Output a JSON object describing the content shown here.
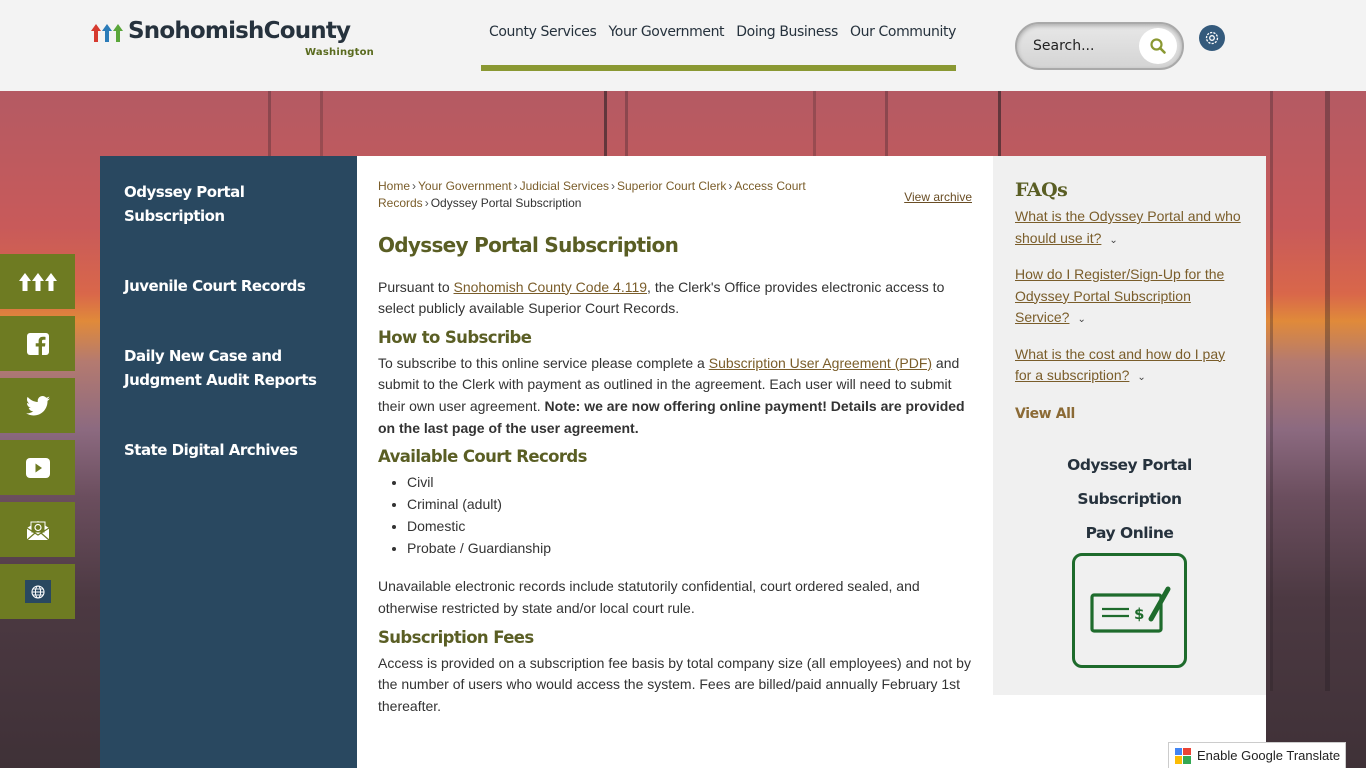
{
  "header": {
    "logo_text": "SnohomishCounty",
    "logo_sub": "Washington",
    "nav": [
      "County Services",
      "Your Government",
      "Doing Business",
      "Our Community"
    ],
    "search_placeholder": "Search...",
    "search_icon": "search-icon",
    "settings_icon": "gear-icon"
  },
  "colors": {
    "olive": "#6e7b22",
    "nav_underline": "#8a9832",
    "navy": "#294860",
    "heading": "#5a5e24",
    "link": "#7a5d2a",
    "pay_green": "#1e6b2c"
  },
  "social": [
    {
      "name": "county-logo-icon"
    },
    {
      "name": "facebook-icon"
    },
    {
      "name": "twitter-icon"
    },
    {
      "name": "youtube-icon"
    },
    {
      "name": "email-icon"
    },
    {
      "name": "globe-icon"
    }
  ],
  "sidebar": {
    "items": [
      {
        "label": "Odyssey Portal Subscription"
      },
      {
        "label": "Juvenile Court Records"
      },
      {
        "label": "Daily New Case and Judgment Audit Reports"
      },
      {
        "label": "State Digital Archives"
      }
    ]
  },
  "breadcrumb": {
    "items": [
      "Home",
      "Your Government",
      "Judicial Services",
      "Superior Court Clerk",
      "Access Court Records"
    ],
    "current": "Odyssey Portal Subscription",
    "separator": "›"
  },
  "view_archive": "View archive",
  "main": {
    "title": "Odyssey Portal Subscription",
    "intro_before": "Pursuant to ",
    "intro_link": "Snohomish County Code 4.119",
    "intro_after": ", the Clerk's Office provides electronic access to select publicly available Superior Court Records.",
    "how_heading": "How to Subscribe",
    "how_before": "To subscribe to this online service please complete a ",
    "how_link": "Subscription User Agreement (PDF)",
    "how_after": " and submit to the Clerk with payment as outlined in the agreement. Each user will need to submit their own user agreement. ",
    "how_bold": "Note: we are now offering online payment! Details are provided on the last page of the user agreement.",
    "records_heading": "Available Court Records",
    "records": [
      "Civil",
      "Criminal (adult)",
      "Domestic",
      "Probate / Guardianship"
    ],
    "unavailable": "Unavailable electronic records include statutorily confidential, court ordered sealed, and otherwise restricted by state and/or local court rule.",
    "fees_heading": "Subscription Fees",
    "fees_text": "Access is provided on a subscription fee basis by total company size (all employees) and not by the number of users who would access the system. Fees are billed/paid annually February 1st thereafter."
  },
  "aside": {
    "faq_title": "FAQs",
    "faqs": [
      "What is the Odyssey Portal and who should use it?",
      "How do I Register/Sign-Up for the Odyssey Portal Subscription Service?",
      "What is the cost and how do I pay for a subscription?"
    ],
    "view_all": "View All",
    "promo_title": "Odyssey Portal Subscription",
    "promo_sub": "Pay Online",
    "pay_icon": "check-payment-icon"
  },
  "translate": {
    "label": "Enable Google Translate"
  }
}
